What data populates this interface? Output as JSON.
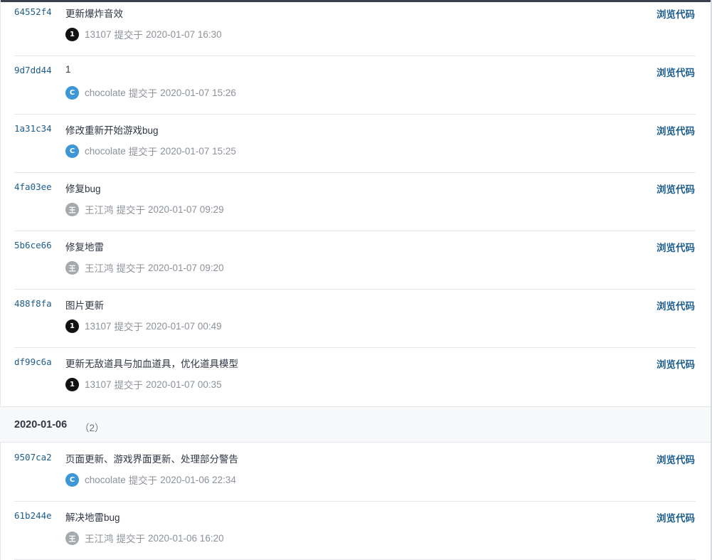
{
  "browse_label": "浏览代码",
  "verb": "提交于",
  "avatar_colors": {
    "1": "#111111",
    "C": "#3d96d6",
    "王": "#a4a9ad"
  },
  "commits_a": [
    {
      "sha": "64552f4",
      "message": "更新爆炸音效",
      "avatar": "1",
      "author": "13107",
      "time": "2020-01-07 16:30"
    },
    {
      "sha": "9d7dd44",
      "message": "1",
      "avatar": "C",
      "author": "chocolate",
      "time": "2020-01-07 15:26"
    },
    {
      "sha": "1a31c34",
      "message": "修改重新开始游戏bug",
      "avatar": "C",
      "author": "chocolate",
      "time": "2020-01-07 15:25"
    },
    {
      "sha": "4fa03ee",
      "message": "修复bug",
      "avatar": "王",
      "author": "王江鸿",
      "time": "2020-01-07 09:29"
    },
    {
      "sha": "5b6ce66",
      "message": "修复地雷",
      "avatar": "王",
      "author": "王江鸿",
      "time": "2020-01-07 09:20"
    },
    {
      "sha": "488f8fa",
      "message": "图片更新",
      "avatar": "1",
      "author": "13107",
      "time": "2020-01-07 00:49"
    },
    {
      "sha": "df99c6a",
      "message": "更新无敌道具与加血道具，优化道具模型",
      "avatar": "1",
      "author": "13107",
      "time": "2020-01-07 00:35"
    }
  ],
  "group": {
    "date": "2020-01-06",
    "count": "（2）"
  },
  "commits_b": [
    {
      "sha": "9507ca2",
      "message": "页面更新、游戏界面更新、处理部分警告",
      "avatar": "C",
      "author": "chocolate",
      "time": "2020-01-06 22:34"
    },
    {
      "sha": "61b244e",
      "message": "解决地雷bug",
      "avatar": "王",
      "author": "王江鸿",
      "time": "2020-01-06 16:20"
    }
  ]
}
